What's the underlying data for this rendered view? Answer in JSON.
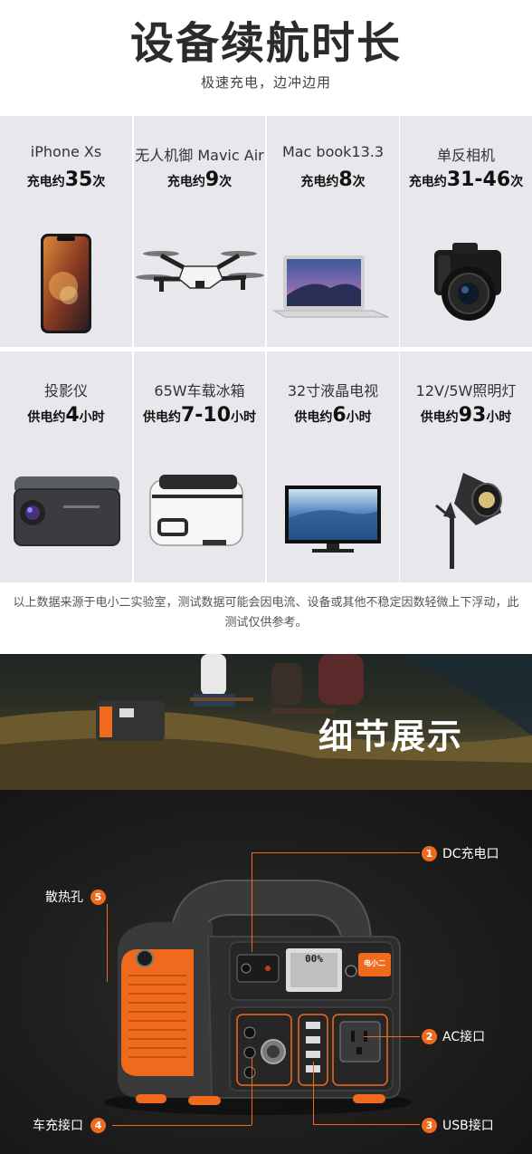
{
  "header": {
    "title": "设备续航时长",
    "subtitle": "极速充电，边冲边用"
  },
  "devices": [
    {
      "name": "iPhone Xs",
      "prefix": "充电约",
      "value": "35",
      "suffix": "次",
      "icon": "smartphone-icon"
    },
    {
      "name": "无人机御 Mavic Air",
      "prefix": "充电约",
      "value": "9",
      "suffix": "次",
      "icon": "drone-icon"
    },
    {
      "name": "Mac book13.3",
      "prefix": "充电约",
      "value": "8",
      "suffix": "次",
      "icon": "laptop-icon"
    },
    {
      "name": "单反相机",
      "prefix": "充电约",
      "value": "31-46",
      "suffix": "次",
      "icon": "camera-icon"
    },
    {
      "name": "投影仪",
      "prefix": "供电约",
      "value": "4",
      "suffix": "小时",
      "icon": "projector-icon"
    },
    {
      "name": "65W车载冰箱",
      "prefix": "供电约",
      "value": "7-10",
      "suffix": "小时",
      "icon": "car-fridge-icon"
    },
    {
      "name": "32寸液晶电视",
      "prefix": "供电约",
      "value": "6",
      "suffix": "小时",
      "icon": "tv-icon"
    },
    {
      "name": "12V/5W照明灯",
      "prefix": "供电约",
      "value": "93",
      "suffix": "小时",
      "icon": "spotlight-icon"
    }
  ],
  "note": "以上数据来源于电小二实验室，测试数据可能会因电流、设备或其他不稳定因数轻微上下浮动，此测试仅供参考。",
  "banner": {
    "title": "细节展示"
  },
  "detail": {
    "brand_logo": "电小二",
    "display_readout": "00%",
    "callouts": [
      {
        "num": "1",
        "label": "DC充电口"
      },
      {
        "num": "2",
        "label": "AC接口"
      },
      {
        "num": "3",
        "label": "USB接口"
      },
      {
        "num": "4",
        "label": "车充接口"
      },
      {
        "num": "5",
        "label": "散热孔"
      }
    ]
  },
  "colors": {
    "accent": "#f06a1e",
    "cell_bg": "#e8e7ec",
    "dark_bg": "#1d1d1d"
  }
}
